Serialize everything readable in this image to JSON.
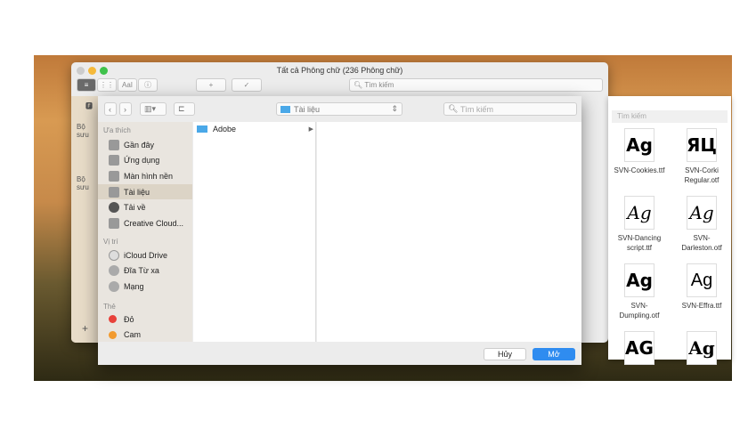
{
  "fontbook": {
    "title": "Tất cả Phông chữ (236 Phông chữ)",
    "search_placeholder": "Tìm kiếm",
    "sidebar_label_1": "Bộ sưu",
    "sidebar_label_2": "Bộ sưu",
    "aa": "AaI",
    "add": "+",
    "check": "✓"
  },
  "fontlist": {
    "search_placeholder": "Tìm kiếm",
    "fonts": [
      {
        "preview": "Ag",
        "name": "SVN-Cookies.ttf"
      },
      {
        "preview": "ЯЦ",
        "name": "SVN-Corki Regular.otf"
      },
      {
        "preview": "Ag",
        "name": "SVN-Dancing script.ttf"
      },
      {
        "preview": "Ag",
        "name": "SVN-Darleston.otf"
      },
      {
        "preview": "Ag",
        "name": "SVN-Dumpling.otf"
      },
      {
        "preview": "Ag",
        "name": "SVN-Effra.ttf"
      },
      {
        "preview": "AG",
        "name": ""
      },
      {
        "preview": "Ag",
        "name": ""
      }
    ]
  },
  "dialog": {
    "location": "Tài liệu",
    "search_placeholder": "Tìm kiếm",
    "sections": {
      "favorites": "Ưa thích",
      "locations": "Vị trí",
      "tags": "Thẻ"
    },
    "favorites": [
      "Gần đây",
      "Ứng dụng",
      "Màn hình nền",
      "Tài liệu",
      "Tải về",
      "Creative Cloud..."
    ],
    "locations": [
      "iCloud Drive",
      "Đĩa Từ xa",
      "Mạng"
    ],
    "tags": [
      {
        "label": "Đỏ",
        "color": "#e8413a"
      },
      {
        "label": "Cam",
        "color": "#f29a2e"
      }
    ],
    "files": [
      "Adobe"
    ],
    "cancel": "Hủy",
    "open": "Mở",
    "accent": "#2f8cf0"
  }
}
